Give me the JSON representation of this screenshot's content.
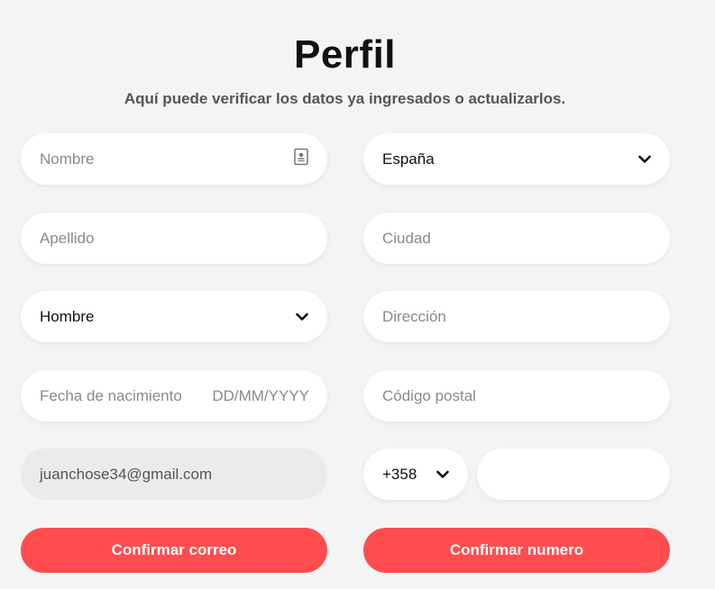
{
  "header": {
    "title": "Perfil",
    "subtitle": "Aquí puede verificar los datos ya ingresados o actualizarlos."
  },
  "form": {
    "nombre": {
      "placeholder": "Nombre"
    },
    "apellido": {
      "placeholder": "Apellido"
    },
    "genero": {
      "selected": "Hombre"
    },
    "fecha_nacimiento": {
      "label": "Fecha de nacimiento",
      "format": "DD/MM/YYYY"
    },
    "email": {
      "value": "juanchose34@gmail.com"
    },
    "pais": {
      "selected": "España"
    },
    "ciudad": {
      "placeholder": "Ciudad"
    },
    "direccion": {
      "placeholder": "Dirección"
    },
    "codigo_postal": {
      "placeholder": "Código postal"
    },
    "telefono": {
      "prefix": "+358",
      "number": ""
    }
  },
  "buttons": {
    "confirmar_correo": "Confirmar correo",
    "confirmar_numero": "Confirmar numero"
  },
  "colors": {
    "accent": "#ff4d4f",
    "background": "#f4f4f4",
    "field": "#ffffff",
    "field_disabled": "#ebebeb"
  },
  "icons": {
    "nombre_field": "contact-card-icon",
    "dropdowns": "chevron-down-icon"
  }
}
